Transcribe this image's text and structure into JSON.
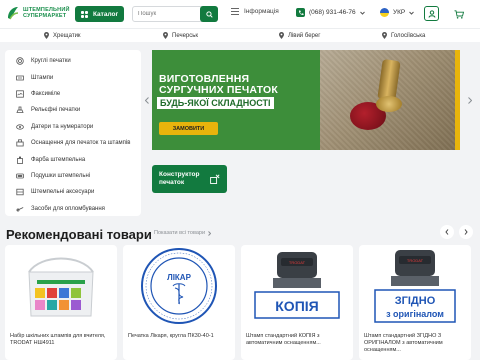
{
  "header": {
    "logo_line1": "ШТЕМПЕЛЬНИЙ",
    "logo_line2": "СУПЕРМАРКЕТ",
    "catalog_label": "Каталог",
    "search_placeholder": "Пошук",
    "info_label": "Інформація",
    "phone": "(068) 931-46-76",
    "lang": "УКР",
    "brand_color": "#127a3f"
  },
  "locations": [
    "Хрещатик",
    "Печерськ",
    "Лівий берег",
    "Голосіївська"
  ],
  "sidebar": {
    "items": [
      {
        "label": "Круглі печатки",
        "icon": "round-stamp-icon"
      },
      {
        "label": "Штампи",
        "icon": "stamp-icon"
      },
      {
        "label": "Факсиміле",
        "icon": "signature-icon"
      },
      {
        "label": "Рельєфні печатки",
        "icon": "relief-stamp-icon"
      },
      {
        "label": "Датери та нумератори",
        "icon": "dater-icon"
      },
      {
        "label": "Оснащення для печаток та штампів",
        "icon": "equipment-icon"
      },
      {
        "label": "Фарба штемпельна",
        "icon": "ink-icon"
      },
      {
        "label": "Подушки штемпельні",
        "icon": "pad-icon"
      },
      {
        "label": "Штемпельні аксесуари",
        "icon": "accessories-icon"
      },
      {
        "label": "Засоби для опломбування",
        "icon": "seal-tools-icon"
      }
    ]
  },
  "banner": {
    "line1": "ВИГОТОВЛЕННЯ",
    "line2": "СУРГУЧНИХ ПЕЧАТОК",
    "tag": "БУДЬ-ЯКОЇ СКЛАДНОСТІ",
    "cta": "ЗАМОВИТИ"
  },
  "constructor": {
    "line1": "Конструктор",
    "line2": "печаток"
  },
  "recommended": {
    "title": "Рекомендовані товари",
    "see_all": "Показати всі товари",
    "products": [
      {
        "name": "Набір шкільних штампів для вчителя, TRODAT НШ4911"
      },
      {
        "name": "Печатка Лікаря, кругла ПК30-40-1",
        "stamp_text": "ЛІКАР"
      },
      {
        "name": "Штамп стандартний КОПІЯ з автоматичним оснащенням...",
        "stamp_text": "КОПІЯ"
      },
      {
        "name": "Штамп стандартний ЗГІДНО З ОРИГІНАЛОМ з автоматичним оснащенням...",
        "stamp_text_1": "ЗГІДНО",
        "stamp_text_2": "з оригіналом"
      }
    ]
  }
}
